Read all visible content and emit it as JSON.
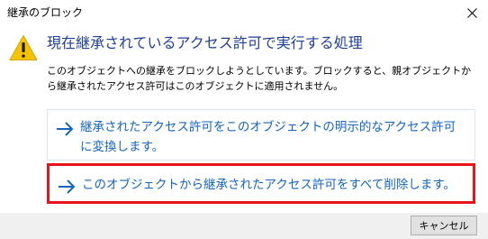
{
  "window": {
    "title": "継承のブロック",
    "close_icon": "close-icon"
  },
  "dialog": {
    "icon": "warning-icon",
    "heading": "現在継承されているアクセス許可で実行する処理",
    "description": "このオブジェクトへの継承をブロックしようとしています。ブロックすると、親オブジェクトから継承されたアクセス許可はこのオブジェクトに適用されません。",
    "options": [
      {
        "icon": "arrow-right-icon",
        "label": "継承されたアクセス許可をこのオブジェクトの明示的なアクセス許可に変換します。"
      },
      {
        "icon": "arrow-right-icon",
        "label": "このオブジェクトから継承されたアクセス許可をすべて削除します。",
        "highlighted": true
      }
    ]
  },
  "footer": {
    "cancel_label": "キャンセル"
  },
  "colors": {
    "heading": "#1f3f9a",
    "link": "#1565c0",
    "highlight_border": "#e8141c",
    "warning": "#f6c500",
    "footer_bg": "#f0f0f0"
  }
}
